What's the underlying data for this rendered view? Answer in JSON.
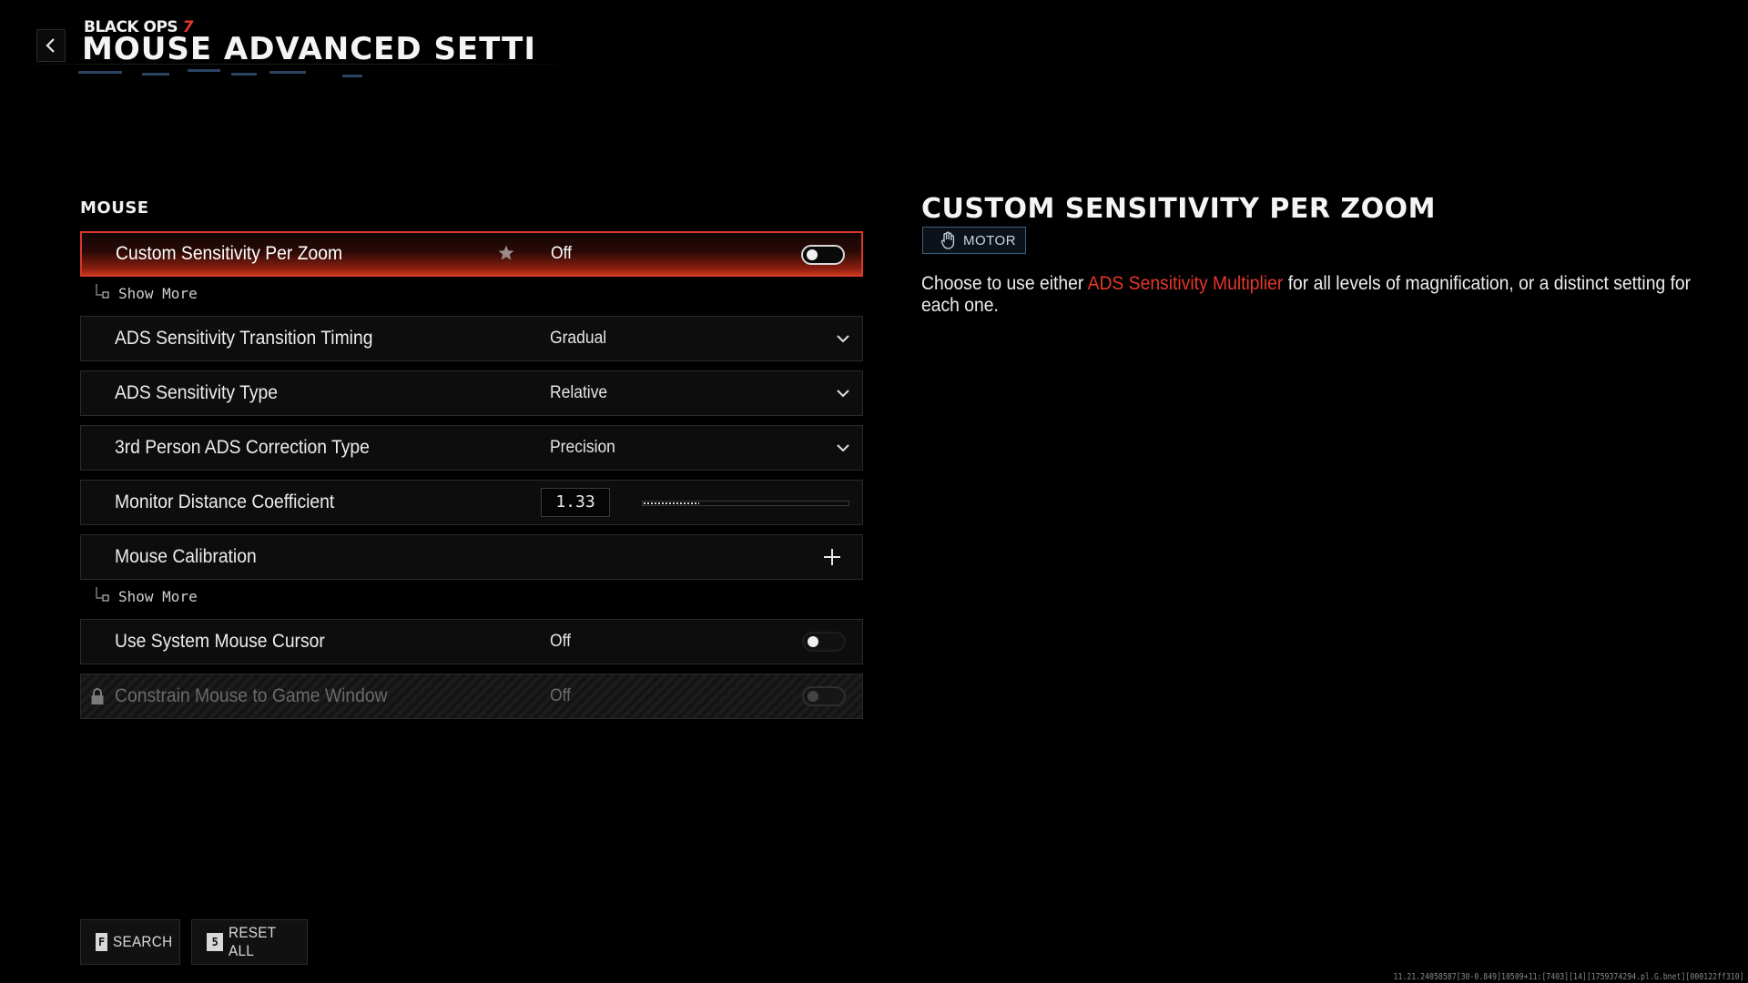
{
  "header": {
    "brand_text": "BLACK OPS",
    "brand_number": "7",
    "title": "MOUSE ADVANCED SETTINGS"
  },
  "section": {
    "title": "MOUSE"
  },
  "settings": [
    {
      "label": "Custom Sensitivity Per Zoom",
      "value": "Off",
      "control": "toggle",
      "toggle_on": false,
      "favorite": true,
      "selected": true
    },
    {
      "label": "ADS Sensitivity Transition Timing",
      "value": "Gradual",
      "control": "dropdown"
    },
    {
      "label": "ADS Sensitivity Type",
      "value": "Relative",
      "control": "dropdown"
    },
    {
      "label": "3rd Person ADS Correction Type",
      "value": "Precision",
      "control": "dropdown"
    },
    {
      "label": "Monitor Distance Coefficient",
      "value": "1.33",
      "control": "slider",
      "slider_fraction": 0.27
    },
    {
      "label": "Mouse Calibration",
      "control": "expand"
    },
    {
      "label": "Use System Mouse Cursor",
      "value": "Off",
      "control": "toggle",
      "toggle_on": false
    },
    {
      "label": "Constrain Mouse to Game Window",
      "value": "Off",
      "control": "toggle",
      "toggle_on": false,
      "locked": true
    }
  ],
  "show_more_label": "Show More",
  "detail": {
    "title": "CUSTOM SENSITIVITY PER ZOOM",
    "tag": "MOTOR",
    "tag_icon": "hand-icon",
    "desc_before": "Choose to use either ",
    "desc_highlight": "ADS Sensitivity Multiplier",
    "desc_after": " for all levels of magnification, or a distinct setting for each one."
  },
  "footer": {
    "search_key": "F",
    "search_label": "SEARCH",
    "reset_key": "5",
    "reset_label": "RESET ALL"
  },
  "build_info": "11.21.24058587[30-0.849]10509+11:[7403][14][1759374294.pl.G.bnet][000122ff310]",
  "colors": {
    "accent": "#e5372b",
    "selected_gradient_end": "#c33517",
    "tag_border": "#3c5f80",
    "background": "#000000"
  }
}
